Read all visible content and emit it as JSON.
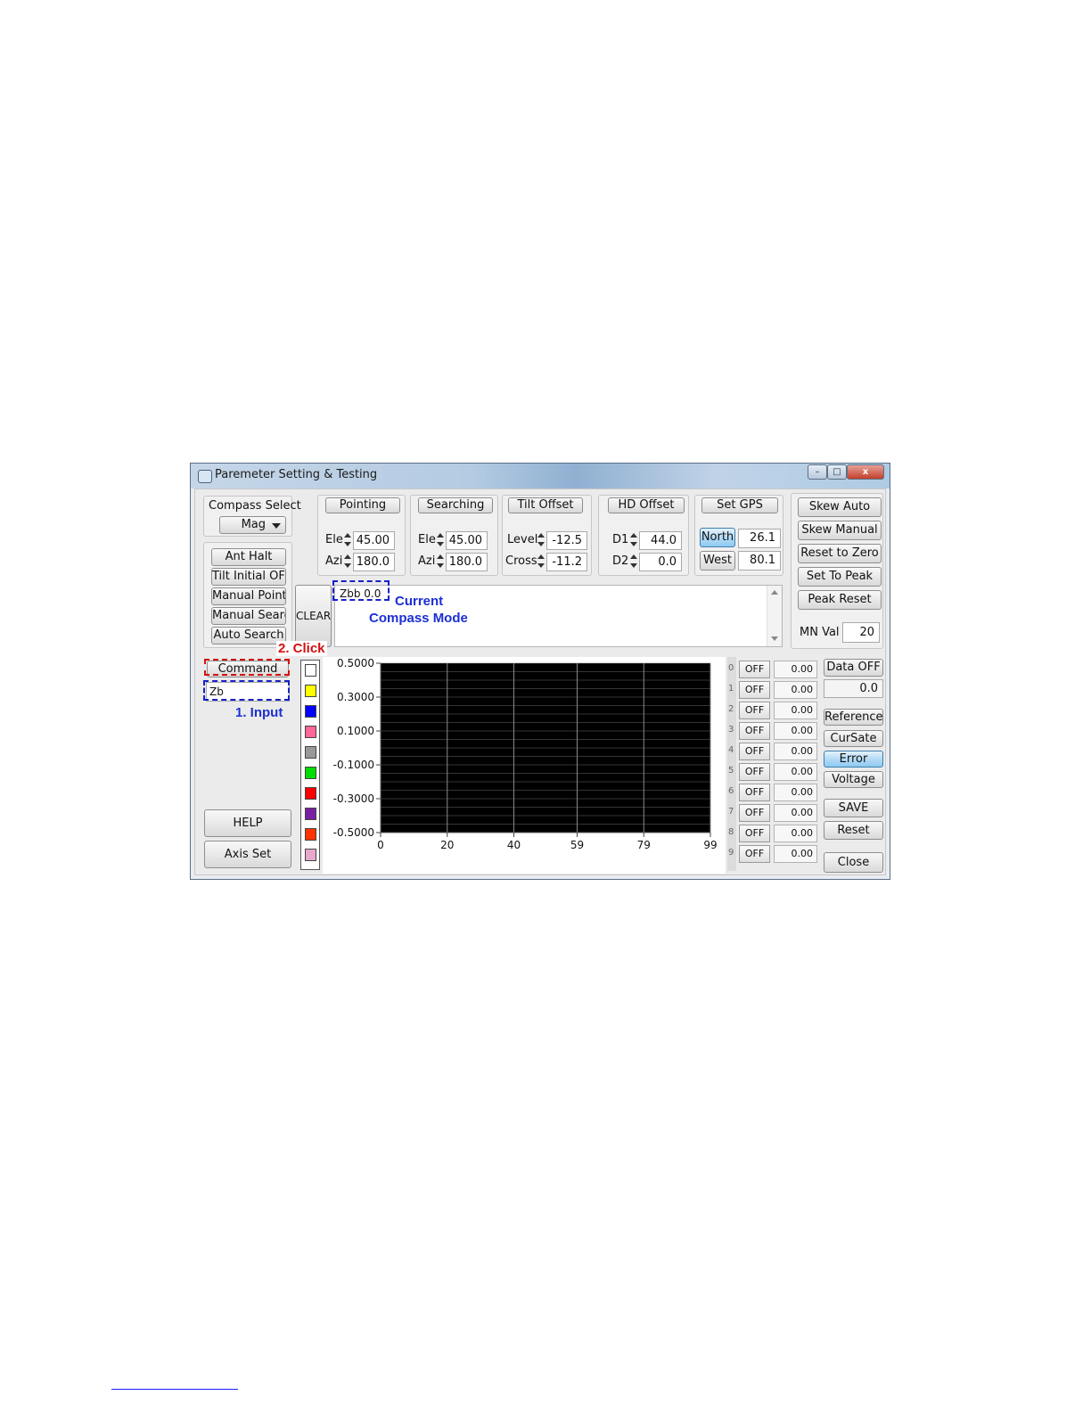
{
  "window": {
    "title": "Paremeter Setting & Testing",
    "minimize": "–",
    "maximize": "□",
    "close": "x"
  },
  "compass": {
    "label": "Compass Select",
    "value": "Mag"
  },
  "left_buttons": [
    "Ant Halt",
    "Tilt Initial OFF",
    "Manual Point",
    "Manual Search",
    "Auto Search"
  ],
  "pointing": {
    "title": "Pointing",
    "ele_label": "Ele",
    "ele": "45.00",
    "azi_label": "Azi",
    "azi": "180.0"
  },
  "searching": {
    "title": "Searching",
    "ele_label": "Ele",
    "ele": "45.00",
    "azi_label": "Azi",
    "azi": "180.0"
  },
  "tilt_offset": {
    "title": "Tilt Offset",
    "level_label": "Level",
    "level": "-12.5",
    "cross_label": "Cross",
    "cross": "-11.2"
  },
  "hd_offset": {
    "title": "HD Offset",
    "d1_label": "D1",
    "d1": "44.0",
    "d2_label": "D2",
    "d2": "0.0"
  },
  "gps": {
    "title": "Set GPS",
    "north_label": "North",
    "north": "26.1",
    "west_label": "West",
    "west": "80.1"
  },
  "right_buttons": [
    "Skew Auto",
    "Skew Manual",
    "Reset to Zero",
    "Set To Peak",
    "Peak Reset"
  ],
  "mn": {
    "label": "MN Val",
    "value": "20"
  },
  "clear_label": "CLEAR",
  "log_text": "Zbb 0.0",
  "command": {
    "label": "Command",
    "input_value": "Zb"
  },
  "help_label": "HELP",
  "axis_set_label": "Axis Set",
  "colors": {
    "swatches": [
      "#ffffff",
      "#ffff00",
      "#0000ff",
      "#ff6699",
      "#999999",
      "#00dd00",
      "#ff0000",
      "#7b1fa2",
      "#ff3300",
      "#e8a8cc"
    ],
    "plot_bg": "#000000",
    "annotation_blue": "#1c2fd4",
    "annotation_red": "#d41010"
  },
  "chart_data": {
    "type": "line",
    "x_ticks": [
      "0",
      "20",
      "40",
      "59",
      "79",
      "99"
    ],
    "y_ticks": [
      "0.5000",
      "0.3000",
      "0.1000",
      "-0.1000",
      "-0.3000",
      "-0.5000"
    ],
    "ylim": [
      -0.5,
      0.5
    ],
    "xlim": [
      0,
      99
    ],
    "series": [],
    "grid": true
  },
  "channels": [
    {
      "idx": "0",
      "state": "OFF",
      "value": "0.00"
    },
    {
      "idx": "1",
      "state": "OFF",
      "value": "0.00"
    },
    {
      "idx": "2",
      "state": "OFF",
      "value": "0.00"
    },
    {
      "idx": "3",
      "state": "OFF",
      "value": "0.00"
    },
    {
      "idx": "4",
      "state": "OFF",
      "value": "0.00"
    },
    {
      "idx": "5",
      "state": "OFF",
      "value": "0.00"
    },
    {
      "idx": "6",
      "state": "OFF",
      "value": "0.00"
    },
    {
      "idx": "7",
      "state": "OFF",
      "value": "0.00"
    },
    {
      "idx": "8",
      "state": "OFF",
      "value": "0.00"
    },
    {
      "idx": "9",
      "state": "OFF",
      "value": "0.00"
    }
  ],
  "data_panel": {
    "data_off": "Data OFF",
    "data_value": "0.0"
  },
  "mode_buttons": {
    "reference": "Reference",
    "cursate": "CurSate",
    "error": "Error",
    "voltage": "Voltage"
  },
  "save_label": "SAVE",
  "reset_label": "Reset",
  "close_label": "Close",
  "annotations": {
    "current": "Current",
    "compass_mode": "Compass Mode",
    "click": "2. Click",
    "input": "1. Input"
  }
}
